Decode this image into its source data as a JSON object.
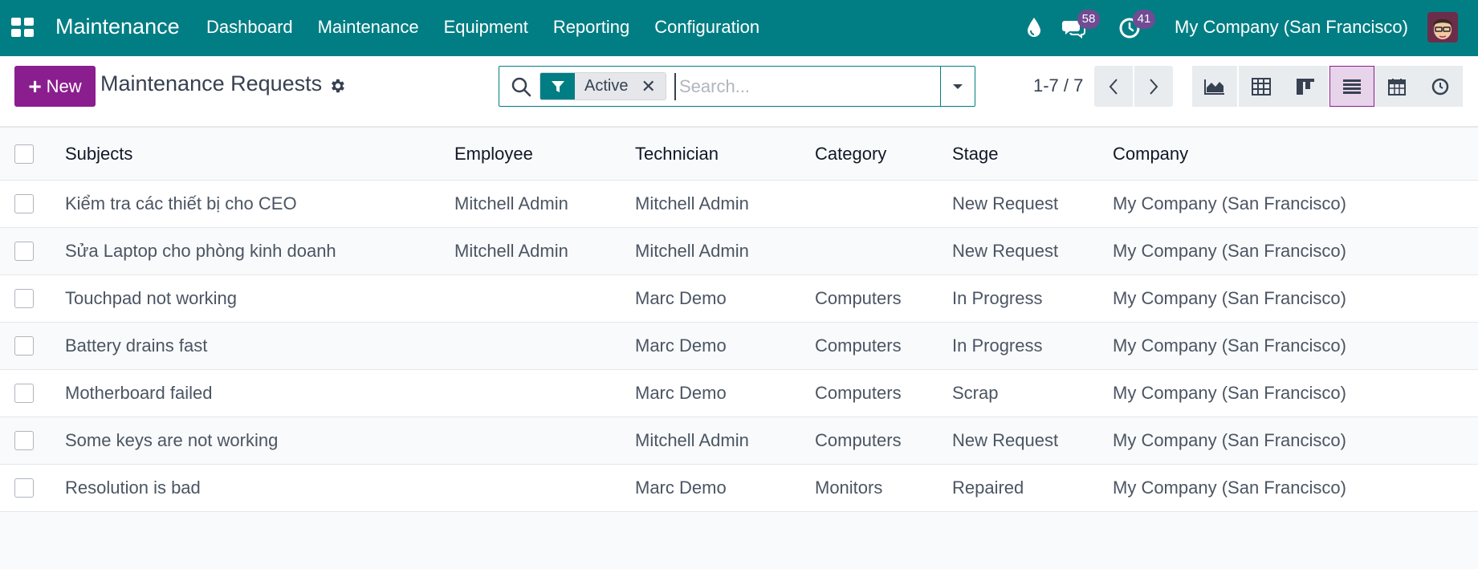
{
  "navbar": {
    "app_name": "Maintenance",
    "menu": [
      "Dashboard",
      "Maintenance",
      "Equipment",
      "Reporting",
      "Configuration"
    ],
    "chat_count": "58",
    "activity_count": "41",
    "company": "My Company (San Francisco)",
    "color": "#017e84"
  },
  "control": {
    "new_label": "New",
    "title": "Maintenance Requests",
    "facet_label": "Active",
    "search_placeholder": "Search...",
    "pager": "1-7 / 7",
    "accent": "#8b1e8e"
  },
  "views": [
    "graph-view-icon",
    "pivot-view-icon",
    "kanban-view-icon",
    "list-view-icon",
    "calendar-view-icon",
    "activity-view-icon"
  ],
  "table": {
    "headers": {
      "subject": "Subjects",
      "employee": "Employee",
      "technician": "Technician",
      "category": "Category",
      "stage": "Stage",
      "company": "Company"
    },
    "rows": [
      {
        "subject": "Kiểm tra các thiết bị cho CEO",
        "employee": "Mitchell Admin",
        "technician": "Mitchell Admin",
        "category": "",
        "stage": "New Request",
        "company": "My Company (San Francisco)"
      },
      {
        "subject": "Sửa Laptop cho phòng kinh doanh",
        "employee": "Mitchell Admin",
        "technician": "Mitchell Admin",
        "category": "",
        "stage": "New Request",
        "company": "My Company (San Francisco)"
      },
      {
        "subject": "Touchpad not working",
        "employee": "",
        "technician": "Marc Demo",
        "category": "Computers",
        "stage": "In Progress",
        "company": "My Company (San Francisco)"
      },
      {
        "subject": "Battery drains fast",
        "employee": "",
        "technician": "Marc Demo",
        "category": "Computers",
        "stage": "In Progress",
        "company": "My Company (San Francisco)"
      },
      {
        "subject": "Motherboard failed",
        "employee": "",
        "technician": "Marc Demo",
        "category": "Computers",
        "stage": "Scrap",
        "company": "My Company (San Francisco)"
      },
      {
        "subject": "Some keys are not working",
        "employee": "",
        "technician": "Mitchell Admin",
        "category": "Computers",
        "stage": "New Request",
        "company": "My Company (San Francisco)"
      },
      {
        "subject": "Resolution is bad",
        "employee": "",
        "technician": "Marc Demo",
        "category": "Monitors",
        "stage": "Repaired",
        "company": "My Company (San Francisco)"
      }
    ]
  }
}
